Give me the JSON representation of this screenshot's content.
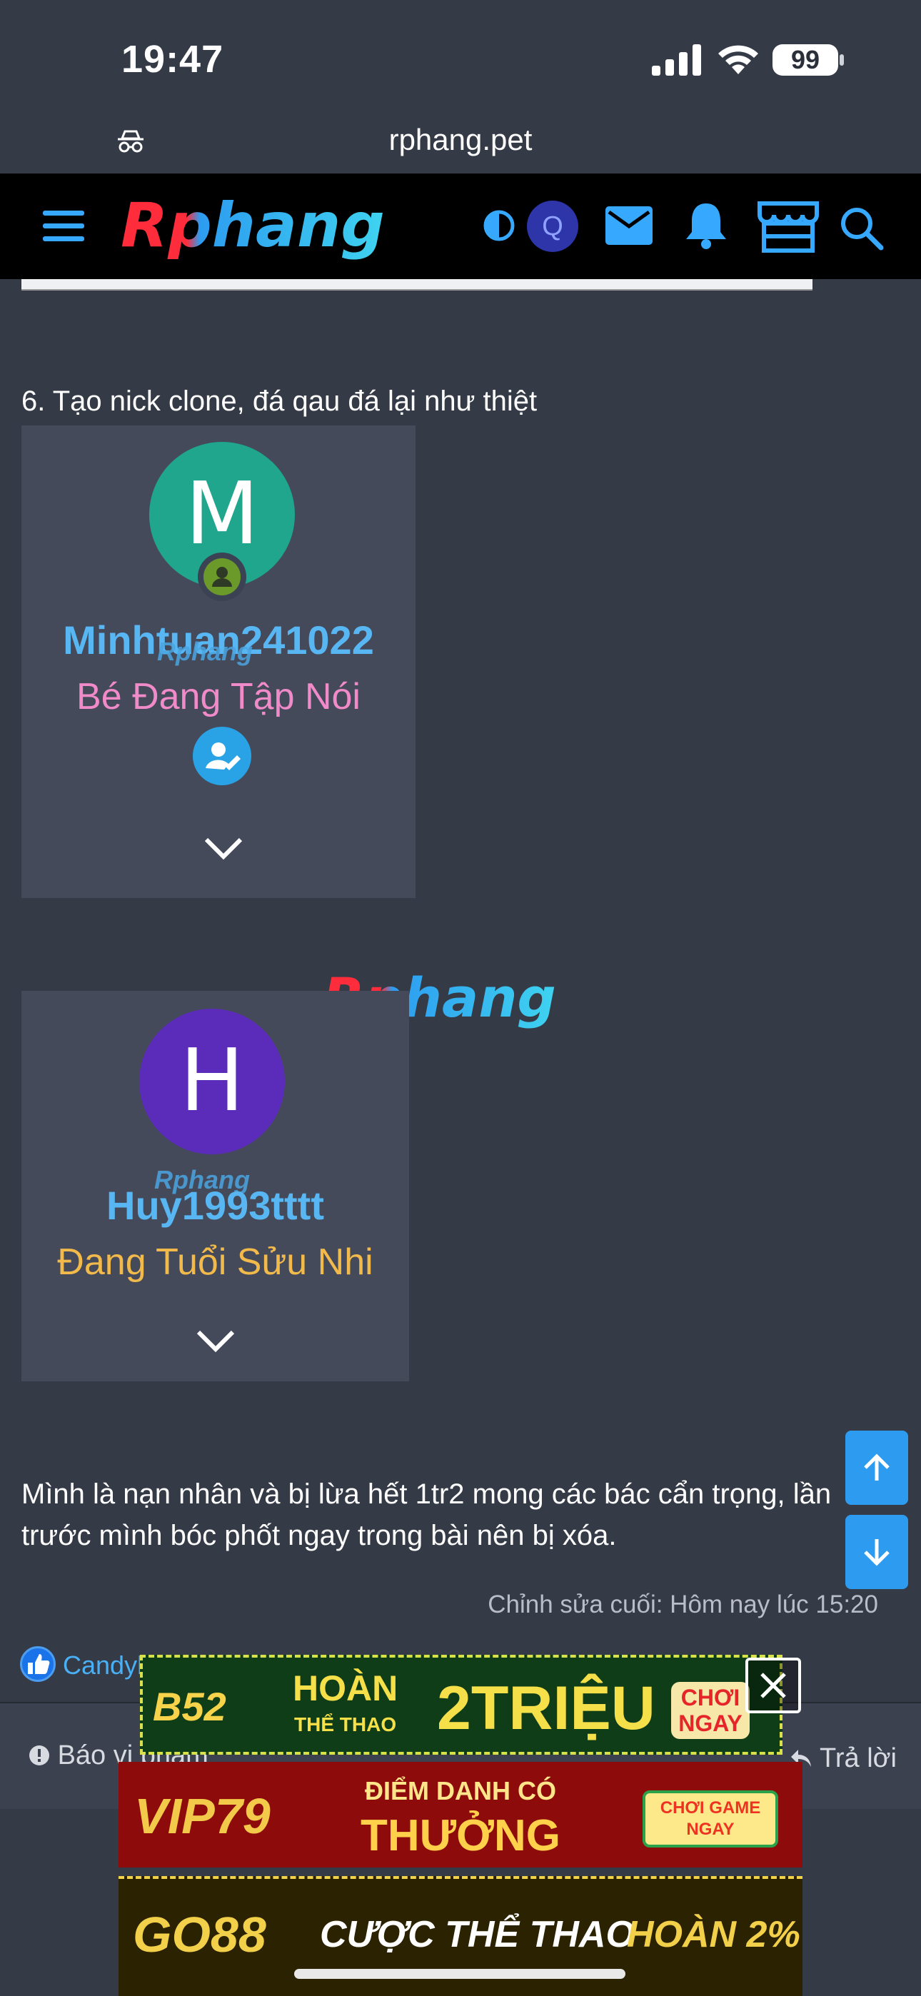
{
  "status_bar": {
    "time": "19:47",
    "battery": "99"
  },
  "browser": {
    "url": "rphang.pet"
  },
  "header": {
    "logo": "Rphang",
    "avatar_letter": "Q"
  },
  "post": {
    "step6": "6. Tạo nick clone, đá qau đá lại như thiệt",
    "card1": {
      "avatar_letter": "M",
      "username": "Minhtuan241022",
      "title": "Bé Đang Tập Nói",
      "watermark": "Rphang"
    },
    "card2": {
      "avatar_letter": "H",
      "username": "Huy1993tttt",
      "title": "Đang Tuổi Sửu Nhi",
      "watermark": "Rphang"
    },
    "watermark": "Rphang",
    "paragraph": "Mình là nạn nhân và bị lừa hết 1tr2 mong các bác cẩn trọng, lần trước mình bóc phốt ngay trong bài nên bị xóa.",
    "edited": "Chỉnh sửa cuối: Hôm nay lúc 15:20",
    "like_user": "Candyl"
  },
  "footer": {
    "report": "Báo vi phạm",
    "reply": "Trả lời"
  },
  "ads": [
    {
      "brand": "B52",
      "line1": "HOÀN",
      "line2": "THỂ THAO",
      "headline": "2TRIỆU",
      "cta": "CHƠI NGAY"
    },
    {
      "brand": "VIP79",
      "line1": "ĐIỂM DANH CÓ",
      "headline": "THƯỞNG",
      "cta": "CHƠI GAME NGAY"
    },
    {
      "brand": "GO88",
      "headline": "CƯỢC THỂ THAO",
      "highlight": "HOÀN 2%"
    }
  ],
  "colors": {
    "background": "#353a47",
    "accent": "#36a9ff",
    "header": "#000000"
  }
}
